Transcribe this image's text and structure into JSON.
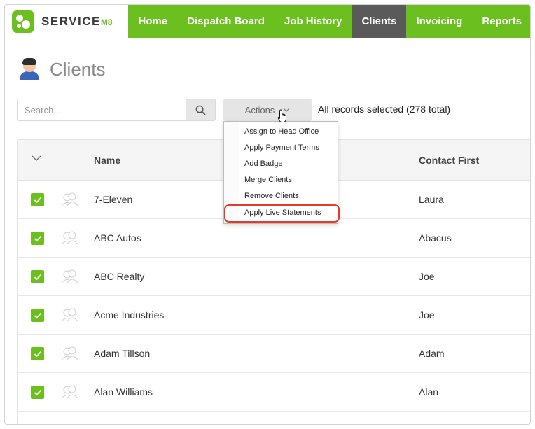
{
  "brand": {
    "name": "SERVICE",
    "suffix": "M8",
    "accent": "#6bbf1f",
    "active_tab_bg": "#5a5a5a",
    "highlight": "#e23b2a"
  },
  "nav": {
    "items": [
      {
        "label": "Home"
      },
      {
        "label": "Dispatch Board"
      },
      {
        "label": "Job History"
      },
      {
        "label": "Clients",
        "active": true
      },
      {
        "label": "Invoicing"
      },
      {
        "label": "Reports"
      }
    ]
  },
  "page": {
    "title": "Clients",
    "icon": "user-icon"
  },
  "search": {
    "placeholder": "Search...",
    "value": "",
    "icon": "search-icon"
  },
  "actions": {
    "label": "Actions",
    "icon": "chevron-down-icon",
    "menu": [
      "Assign to Head Office",
      "Apply Payment Terms",
      "Add Badge",
      "Merge Clients",
      "Remove Clients",
      "Apply Live Statements"
    ],
    "highlighted_item": "Apply Live Statements"
  },
  "selection": {
    "text": "All records selected (278 total)"
  },
  "table": {
    "columns": [
      "Name",
      "Contact First"
    ],
    "rows": [
      {
        "name": "7-Eleven",
        "contact_first": "Laura",
        "checked": true
      },
      {
        "name": "ABC Autos",
        "contact_first": "Abacus",
        "checked": true
      },
      {
        "name": "ABC Realty",
        "contact_first": "Joe",
        "checked": true
      },
      {
        "name": "Acme Industries",
        "contact_first": "Joe",
        "checked": true
      },
      {
        "name": "Adam Tillson",
        "contact_first": "Adam",
        "checked": true
      },
      {
        "name": "Alan Williams",
        "contact_first": "Alan",
        "checked": true
      }
    ]
  }
}
